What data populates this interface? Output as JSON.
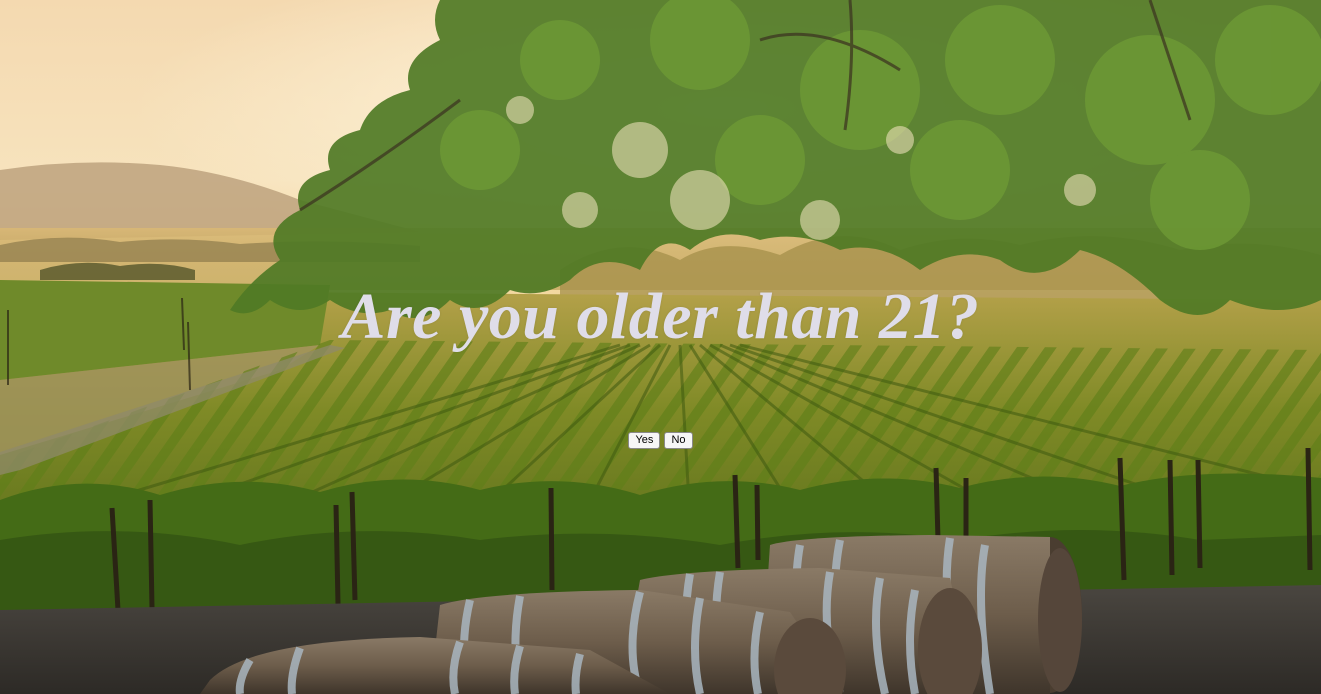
{
  "age_gate": {
    "question": "Are you older than 21?",
    "yes_label": "Yes",
    "no_label": "No"
  },
  "background": {
    "scene": "vineyard-at-sunset-with-wine-barrels"
  },
  "colors": {
    "question_text": "#dfdde9",
    "button_bg": "#f6f6f6",
    "sky": "#f7dcae",
    "foliage": "#4f7a25",
    "vines": "#6f8f1e"
  }
}
